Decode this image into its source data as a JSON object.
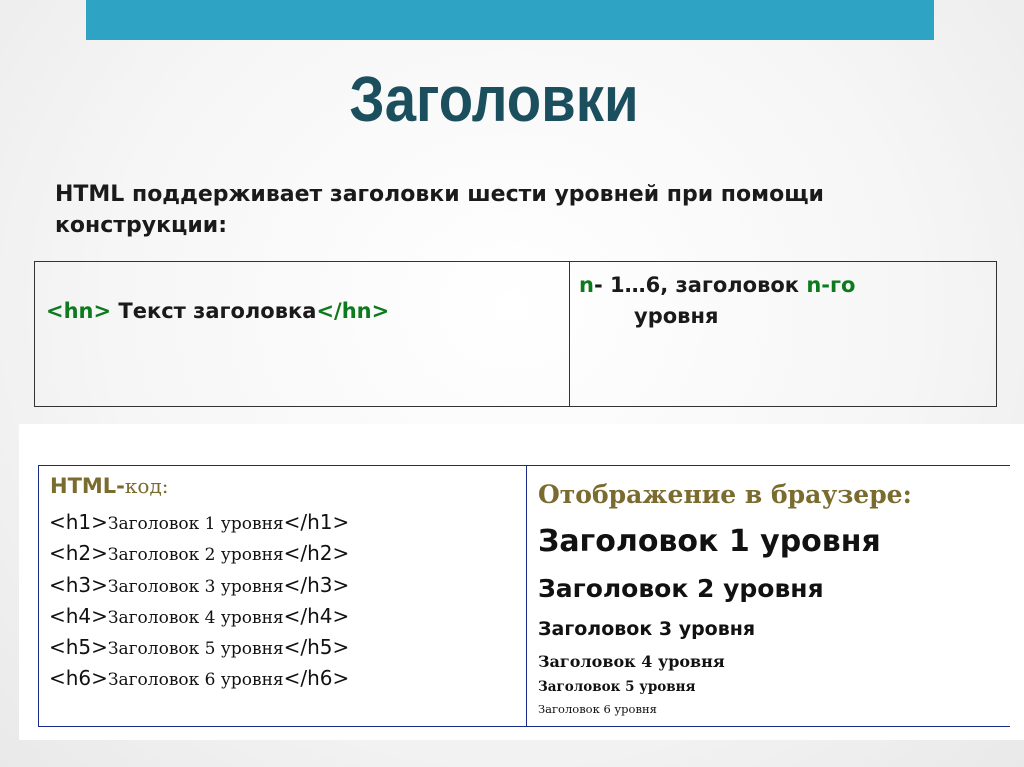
{
  "title": "Заголовки",
  "intro": {
    "line1": "HTML поддерживает заголовки шести уровней при помощи",
    "line2": "конструкции:"
  },
  "syntax": {
    "open_tag": "<hn>",
    "text": " Текст заголовка",
    "close_tag": "</hn>",
    "desc_n": "n",
    "desc_mid": "- 1…6, заголовок ",
    "desc_ngo": "n-го",
    "desc_line2": "уровня"
  },
  "example": {
    "code_header_html": "HTML-",
    "code_header_kod": "код:",
    "code_lines": [
      {
        "open": "<h1>",
        "text": "Заголовок 1 уровня",
        "close": "</h1>"
      },
      {
        "open": "<h2>",
        "text": "Заголовок 2 уровня",
        "close": "</h2>"
      },
      {
        "open": "<h3>",
        "text": "Заголовок 3 уровня",
        "close": "</h3>"
      },
      {
        "open": "<h4>",
        "text": "Заголовок 4 уровня",
        "close": "</h4>"
      },
      {
        "open": "<h5>",
        "text": "Заголовок 5 уровня",
        "close": "</h5>"
      },
      {
        "open": "<h6>",
        "text": "Заголовок 6 уровня",
        "close": "</h6>"
      }
    ],
    "render_header": "Отображение в браузере:",
    "rendered": [
      "Заголовок 1 уровня",
      "Заголовок 2 уровня",
      "Заголовок 3 уровня",
      "Заголовок 4 уровня",
      "Заголовок 5 уровня",
      "Заголовок 6 уровня"
    ]
  },
  "colors": {
    "accent_bar": "#2ea3c3",
    "title": "#1c4f5e",
    "tag_green": "#0e7a1e",
    "example_header": "#7a6b2e",
    "example_border": "#1a2a8a"
  }
}
